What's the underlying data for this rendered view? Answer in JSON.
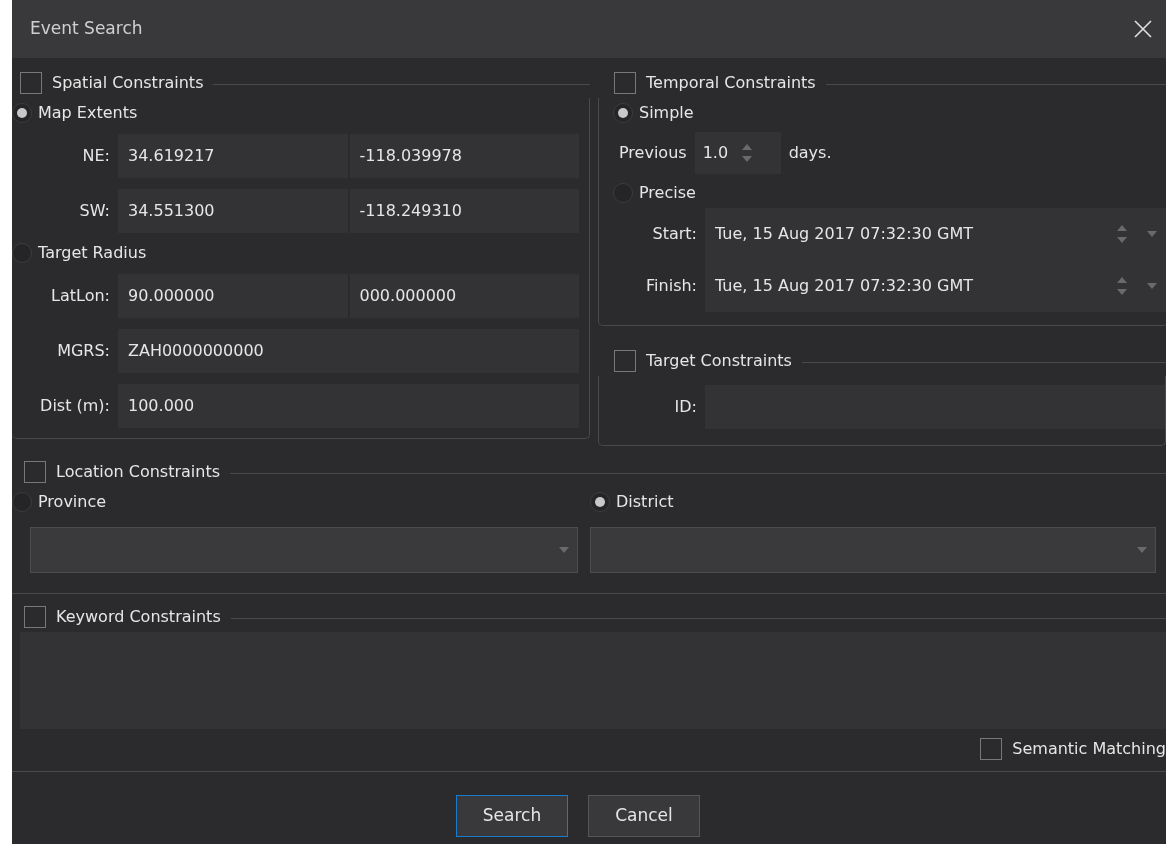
{
  "window": {
    "title": "Event Search"
  },
  "spatial": {
    "label": "Spatial Constraints",
    "checked": false,
    "modes": [
      {
        "label": "Map Extents",
        "selected": true,
        "fields": [
          {
            "label": "NE:",
            "values": [
              "34.619217",
              "-118.039978"
            ]
          },
          {
            "label": "SW:",
            "values": [
              "34.551300",
              "-118.249310"
            ]
          }
        ]
      },
      {
        "label": "Target Radius",
        "selected": false,
        "fields": [
          {
            "label": "LatLon:",
            "values": [
              "90.000000",
              "000.000000"
            ]
          },
          {
            "label": "MGRS:",
            "values": [
              "ZAH0000000000"
            ]
          },
          {
            "label": "Dist (m):",
            "values": [
              "100.000"
            ]
          }
        ]
      }
    ]
  },
  "temporal": {
    "label": "Temporal Constraints",
    "checked": false,
    "simple": {
      "label": "Simple",
      "selected": true,
      "prefix": "Previous",
      "value": "1.0",
      "suffix": "days."
    },
    "precise": {
      "label": "Precise",
      "selected": false,
      "fields": [
        {
          "label": "Start:",
          "value": "Tue, 15 Aug 2017 07:32:30 GMT"
        },
        {
          "label": "Finish:",
          "value": "Tue, 15 Aug 2017 07:32:30 GMT"
        }
      ]
    }
  },
  "target": {
    "label": "Target Constraints",
    "checked": false,
    "fields": [
      {
        "label": "ID:"
      }
    ]
  },
  "location": {
    "label": "Location Constraints",
    "checked": false,
    "options": [
      {
        "label": "Province",
        "selected": false
      },
      {
        "label": "District",
        "selected": true
      }
    ]
  },
  "keyword": {
    "label": "Keyword Constraints",
    "checked": false,
    "semantic": {
      "label": "Semantic Matching",
      "checked": false
    }
  },
  "buttons": [
    {
      "label": "Search",
      "focused": true
    },
    {
      "label": "Cancel",
      "focused": false
    }
  ]
}
